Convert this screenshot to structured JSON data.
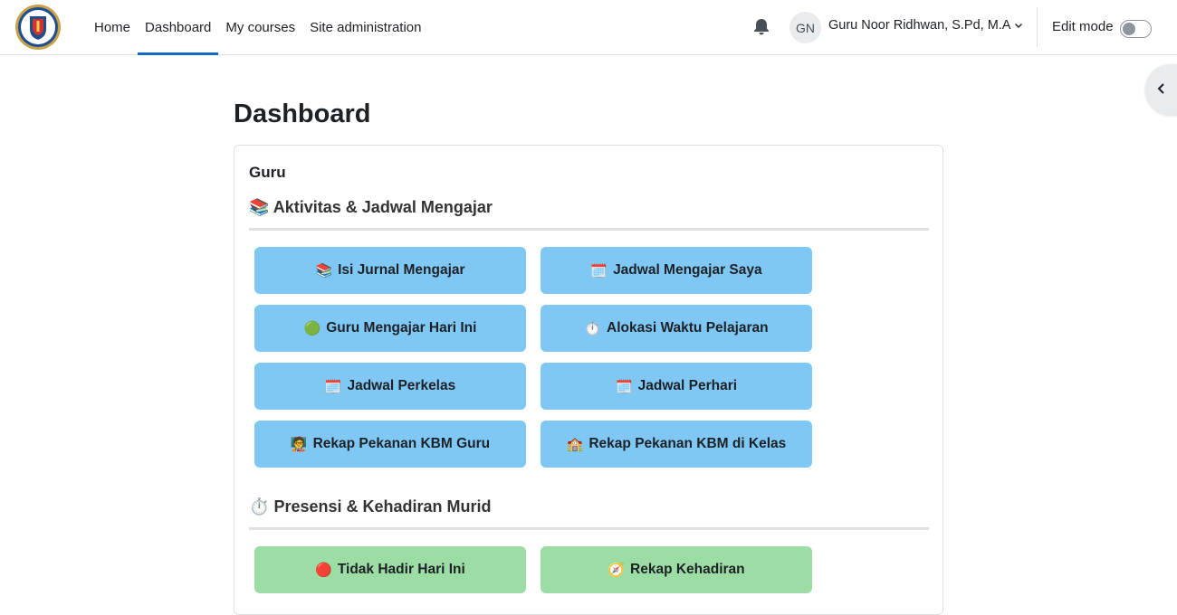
{
  "nav": {
    "links": [
      {
        "label": "Home"
      },
      {
        "label": "Dashboard",
        "active": true
      },
      {
        "label": "My courses"
      },
      {
        "label": "Site administration"
      }
    ],
    "icons": {
      "notifications": "bell-icon",
      "user_menu": "chevron-down-icon"
    },
    "user_initials": "GN",
    "user_name": "Guru Noor Ridhwan, S.Pd, M.A",
    "edit_mode_label": "Edit mode",
    "edit_mode_on": false
  },
  "page": {
    "title": "Dashboard"
  },
  "block": {
    "title": "Guru",
    "sections": [
      {
        "icon": "📚",
        "heading": "Aktivitas & Jadwal Mengajar",
        "color": "#7fc8f5",
        "buttons": [
          {
            "icon": "📚",
            "label": "Isi Jurnal Mengajar"
          },
          {
            "icon": "🗓️",
            "label": "Jadwal Mengajar Saya"
          },
          {
            "icon": "🟢",
            "label": "Guru Mengajar Hari Ini"
          },
          {
            "icon": "⏱️",
            "label": "Alokasi Waktu Pelajaran"
          },
          {
            "icon": "🗓️",
            "label": "Jadwal Perkelas"
          },
          {
            "icon": "🗓️",
            "label": "Jadwal Perhari"
          },
          {
            "icon": "🧑‍🏫",
            "label": "Rekap Pekanan KBM Guru"
          },
          {
            "icon": "🏫",
            "label": "Rekap Pekanan KBM di Kelas"
          }
        ]
      },
      {
        "icon": "⏱️",
        "heading": "Presensi & Kehadiran Murid",
        "color": "#9cdda5",
        "buttons": [
          {
            "icon": "🔴",
            "label": "Tidak Hadir Hari Ini"
          },
          {
            "icon": "🧭",
            "label": "Rekap Kehadiran"
          }
        ]
      }
    ]
  },
  "colors": {
    "accent": "#0f6cbf",
    "blue_button": "#7fc8f5",
    "green_button": "#9cdda5"
  }
}
